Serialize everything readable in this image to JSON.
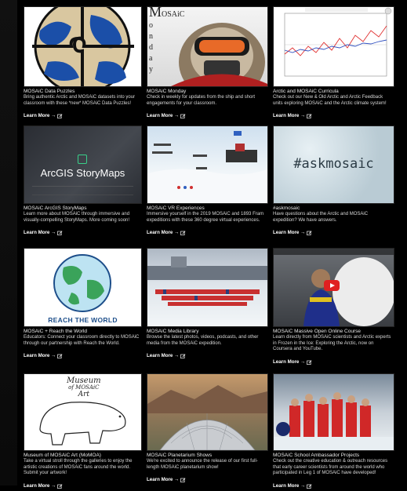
{
  "cards": [
    {
      "title": "MOSAiC Data Puzzles",
      "desc": "Bring authentic Arctic and MOSAiC datasets into your classroom with these *new* MOSAiC Data Puzzles!",
      "more": "Learn More →"
    },
    {
      "title": "MOSAiC Monday",
      "desc": "Check in weekly for updates from the ship and short engagements for your classroom.",
      "more": "Learn More →",
      "thumb_text": [
        "M",
        "OSAiC",
        "o",
        "n",
        "d",
        "a",
        "y"
      ]
    },
    {
      "title": "Arctic and MOSAiC Curricula",
      "desc": "Check out our New & Old Arctic and Arctic Feedback units exploring MOSAiC and the Arctic climate system!",
      "more": "Learn More →"
    },
    {
      "title": "MOSAiC ArcGIS StoryMaps",
      "desc": "Learn more about MOSAiC through immersive and visually-compelling StoryMaps. More coming soon!",
      "more": "Learn More →",
      "thumb_text": "ArcGIS StoryMaps"
    },
    {
      "title": "MOSAiC VR Experiences",
      "desc": "Immersive yourself in the 2019 MOSAiC and 1893 Fram expeditions with these 360 degree virtual experiences.",
      "more": "Learn More →"
    },
    {
      "title": "#askmosaic",
      "desc": "Have questions about the Arctic and MOSAiC expedition? We have answers.",
      "more": "Learn More →",
      "thumb_text": "#askmosaic"
    },
    {
      "title": "MOSAiC + Reach the World",
      "desc": "Educators: Connect your classroom directly to MOSAiC through our partnership with Reach the World.",
      "more": "Learn More →",
      "thumb_text": "REACH THE WORLD"
    },
    {
      "title": "MOSAiC Media Library",
      "desc": "Browse the latest photos, videos, podcasts, and other media from the MOSAiC expedition.",
      "more": "Learn More →"
    },
    {
      "title": "MOSAiC Massive Open Online Course",
      "desc": "Learn directly from MOSAiC scientists and Arctic experts in Frozen in the Ice: Exploring the Arctic, now on Coursera and YouTube.",
      "more": "Learn More →"
    },
    {
      "title": "Museum of MOSAiC Art (MoMOA)",
      "desc": "Take a virtual stroll through the galleries to enjoy the artistic creations of MOSAiC fans around the world. Submit your artwork!",
      "more": "Learn More →",
      "thumb_text": [
        "Museum",
        "of MOSAiC",
        "Art"
      ]
    },
    {
      "title": "MOSAiC Planetarium Shows",
      "desc": "We're excited to announce the release of our first full-length MOSAiC planetarium show!",
      "more": "Learn More →"
    },
    {
      "title": "MOSAiC School Ambassador Projects",
      "desc": "Check out the creative education & outreach resources that early career scientists from around the world who participated in Leg 1 of MOSAiC have developed!",
      "more": "Learn More →"
    }
  ]
}
